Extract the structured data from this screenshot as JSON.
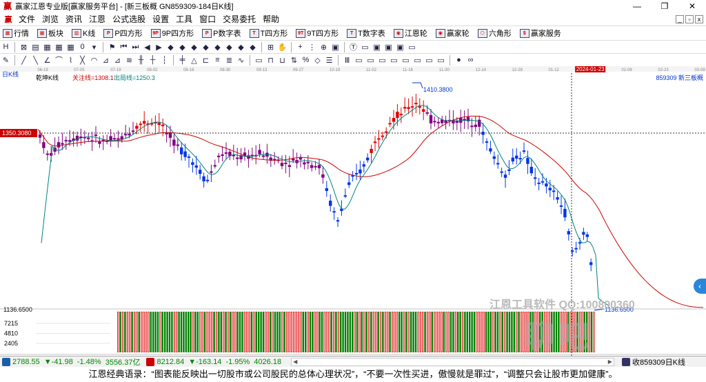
{
  "window": {
    "title": "赢家江恩专业版[赢家服务平台] - [新三板概  GN859309-184日K线]",
    "minimize": "—",
    "restore": "❐",
    "close": "✕"
  },
  "menu": {
    "items": [
      "文件",
      "浏览",
      "资讯",
      "江恩",
      "公式选股",
      "设置",
      "工具",
      "窗口",
      "交易委托",
      "帮助"
    ],
    "mdi_min": "_",
    "mdi_restore": "▫",
    "mdi_close": "x"
  },
  "toolbar1": {
    "items": [
      {
        "icon": "grid-icon",
        "glyph": "▦",
        "label": "行情"
      },
      {
        "icon": "blocks-icon",
        "glyph": "▦",
        "label": "板块"
      },
      {
        "icon": "kline-icon",
        "glyph": "▥",
        "label": "K线"
      },
      {
        "icon": "p-square-icon",
        "glyph": "P",
        "label": "P四方形"
      },
      {
        "icon": "9p-square-icon",
        "glyph": "9P",
        "label": "9P四方形"
      },
      {
        "icon": "p-table-icon",
        "glyph": "P",
        "label": "P数字表"
      },
      {
        "icon": "t-square-icon",
        "glyph": "T",
        "label": "T四方形"
      },
      {
        "icon": "9t-square-icon",
        "glyph": "9T",
        "label": "9T四方形"
      },
      {
        "icon": "t-table-icon",
        "glyph": "T",
        "label": "T数字表"
      },
      {
        "icon": "gann-wheel-icon",
        "glyph": "◉",
        "label": "江恩轮"
      },
      {
        "icon": "winner-wheel-icon",
        "glyph": "◉",
        "label": "赢家轮"
      },
      {
        "icon": "hexagon-icon",
        "glyph": "⬡",
        "label": "六角形"
      },
      {
        "icon": "service-icon",
        "glyph": "$",
        "label": "赢家服务"
      }
    ]
  },
  "toolbar2": {
    "icons": [
      "H",
      "⊠",
      "▤",
      "▦",
      "▦",
      "▦",
      "0",
      "▾",
      "⚑",
      "⏮",
      "⏭",
      "◀",
      "▶",
      "◆",
      "◆",
      "◆",
      "◆",
      "◆",
      "◆",
      "◆",
      "◆",
      "⊞",
      "✋",
      "+",
      "⋮",
      "⊕",
      "▣",
      "Ⓣ",
      "▭",
      "▣",
      "▣",
      "▣",
      "▭"
    ]
  },
  "toolbar3": {
    "icons": [
      "✎",
      "╱",
      "╲",
      "∠",
      "⌒",
      "⌇",
      "╳",
      "◠",
      "⊿",
      "⊿",
      "≋",
      "╫",
      "┼",
      "┆",
      "╪",
      "△",
      "⊏",
      "≡",
      "≣",
      "∿",
      "▭",
      "⊓",
      "⊔",
      "⇅",
      "%",
      "◇",
      "☰",
      "Ⅲ",
      "▭",
      "▭",
      "▭",
      "▭",
      "▭",
      "▭",
      "▭",
      "▭",
      "●",
      "∞"
    ]
  },
  "chart": {
    "period_label": "日K线",
    "indicator_name": "乾坤K线",
    "attention_line": "关注线=1308.1",
    "exit_line": "出局线=1250.3",
    "code_label": "859309  新三板概",
    "cursor_price": "1350.3080",
    "cursor_date": "2024-01-23",
    "high_label": "1410.3800",
    "low_label": "1136.6500",
    "axis_low_value": "1136.6500",
    "volume_ticks": [
      "7215",
      "4810",
      "2405"
    ],
    "date_ticks": [
      "06-19",
      "07-05",
      "07-19",
      "08-02",
      "08-16",
      "08-30",
      "09-13",
      "09-27",
      "10-19",
      "11-02",
      "11-16",
      "11-30",
      "12-14",
      "12-28",
      "01-12",
      "2024-01-23",
      "02-09",
      "02-23",
      "03-08"
    ],
    "colors": {
      "up": "#e00000",
      "down": "#0033ee",
      "neutral": "#800080",
      "ma_long": "#cc0000",
      "ma_short": "#008080",
      "volume": "#008000"
    }
  },
  "watermark": {
    "line1": "江恩工具软件  QQ:100800360",
    "line2": "聊吧"
  },
  "status": {
    "sh_value": "2788.55",
    "sh_change": "▼-41.98",
    "sh_pct": "-1.48%",
    "sh_amount": "3556.37亿",
    "sz_value": "8212.84",
    "sz_change": "▼-163.14",
    "sz_pct": "-1.95%",
    "sz_amount": "4026.18",
    "right_label": "收859309日K线"
  },
  "motto": "江恩经典语录：“图表能反映出一切股市或公司股民的总体心理状况”，“不要一次性买进，傲慢就是罪过”，“调整只会让股市更加健康”。"
}
